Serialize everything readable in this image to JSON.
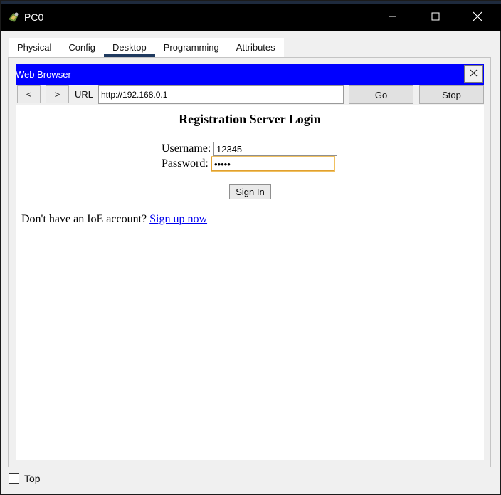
{
  "window": {
    "title": "PC0",
    "controls": {
      "minimize": "minimize-icon",
      "maximize": "maximize-icon",
      "close": "close-icon"
    }
  },
  "tabs": [
    {
      "label": "Physical",
      "active": false
    },
    {
      "label": "Config",
      "active": false
    },
    {
      "label": "Desktop",
      "active": true
    },
    {
      "label": "Programming",
      "active": false
    },
    {
      "label": "Attributes",
      "active": false
    }
  ],
  "browser": {
    "title": "Web Browser",
    "back_label": "<",
    "forward_label": ">",
    "url_label": "URL",
    "url_value": "http://192.168.0.1",
    "go_label": "Go",
    "stop_label": "Stop"
  },
  "page": {
    "title": "Registration Server Login",
    "username_label": "Username:",
    "username_value": "12345",
    "password_label": "Password:",
    "password_value": "•••••",
    "signin_label": "Sign In",
    "signup_prompt": "Don't have an IoE account?",
    "signup_link": "Sign up now"
  },
  "footer": {
    "top_label": "Top",
    "top_checked": false
  },
  "colors": {
    "titlebar": "#000000",
    "browser_titlebar": "#0000ff",
    "active_tab_underline": "#1f3a5f",
    "link": "#0000ee",
    "focus_border": "#e0a030"
  }
}
